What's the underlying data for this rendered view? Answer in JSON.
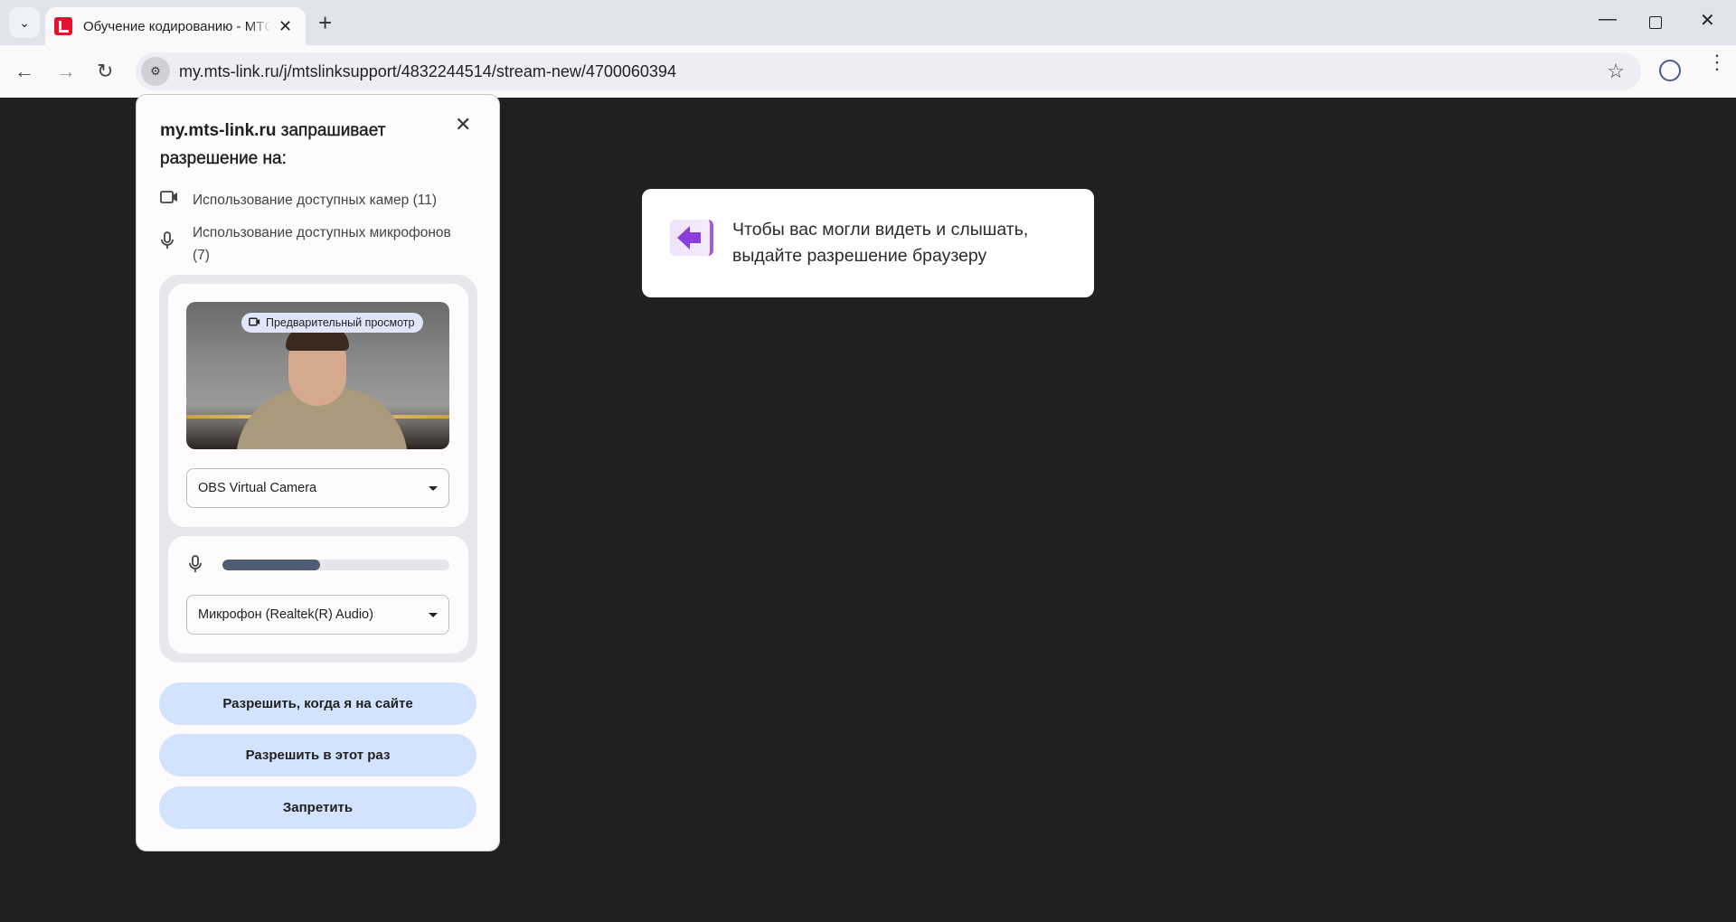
{
  "browser": {
    "tab_title": "Обучение кодированию - МТС Линк",
    "url": "my.mts-link.ru/j/mtslinksupport/4832244514/stream-new/4700060394"
  },
  "permission_popup": {
    "site": "my.mts-link.ru",
    "title_rest": " запрашивает разрешение на:",
    "camera_permission": "Использование доступных камер (11)",
    "mic_permission": "Использование доступных микрофонов (7)",
    "preview_badge": "Предварительный просмотр",
    "camera_select": "OBS Virtual Camera",
    "mic_select": "Микрофон (Realtek(R) Audio)",
    "mic_level_percent": 43,
    "buttons": {
      "allow_on_site": "Разрешить, когда я на сайте",
      "allow_once": "Разрешить в этот раз",
      "deny": "Запретить"
    }
  },
  "hint": {
    "text": "Чтобы вас могли видеть и слышать, выдайте разрешение браузеру"
  },
  "colors": {
    "button_bg": "#d3e3fd",
    "accent_purple": "#8a3fdc",
    "page_bg": "#202020"
  }
}
